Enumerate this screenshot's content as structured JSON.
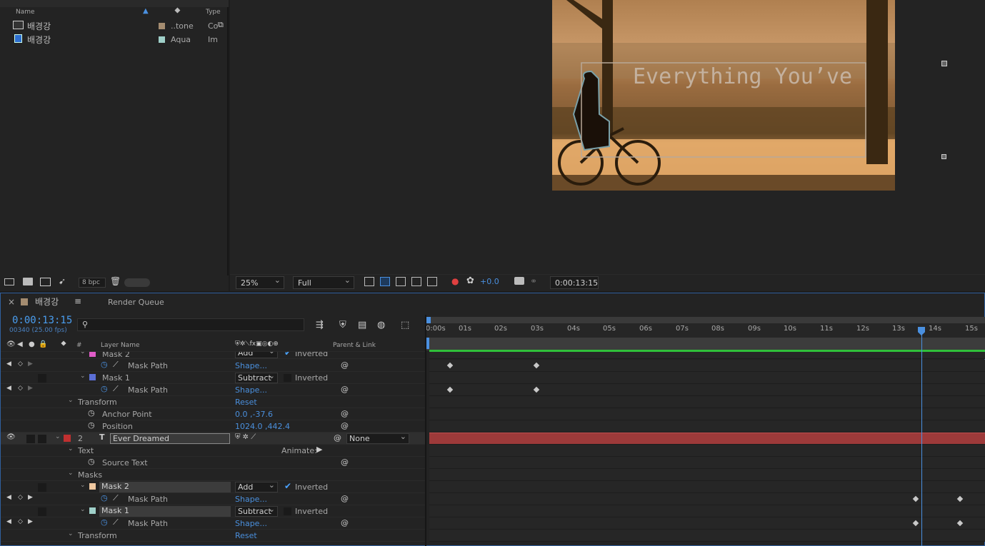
{
  "project": {
    "headers": {
      "name": "Name",
      "type": "Type"
    },
    "items": [
      {
        "name": "배경강",
        "label": "..tone",
        "type": "Co",
        "swatch": "#a48c70"
      },
      {
        "name": "배경강",
        "label": "Aqua",
        "type": "Im",
        "swatch": "#9fd0c9"
      }
    ],
    "bpc": "8 bpc"
  },
  "viewer": {
    "overlay_text": "Everything You’ve",
    "zoom": "25%",
    "resolution": "Full",
    "exposure": "+0.0",
    "timecode": "0:00:13:15"
  },
  "timeline": {
    "comp_tab": "배경강",
    "render_queue": "Render Queue",
    "timecode": "0:00:13:15",
    "frame_info": "00340 (25.00 fps)",
    "search_placeholder": "",
    "col_layer_name": "Layer Name",
    "col_parent": "Parent & Link",
    "col_hash": "#",
    "ruler": [
      "0:00s",
      "01s",
      "02s",
      "03s",
      "04s",
      "05s",
      "06s",
      "07s",
      "08s",
      "09s",
      "10s",
      "11s",
      "12s",
      "13s",
      "14s",
      "15s"
    ],
    "rows": {
      "mask2a": {
        "name": "Mask 2",
        "mode": "Add",
        "inverted": "Inverted"
      },
      "maskpath2a": {
        "name": "Mask Path",
        "value": "Shape..."
      },
      "mask1a": {
        "name": "Mask 1",
        "mode": "Subtract",
        "inverted": "Inverted"
      },
      "maskpath1a": {
        "name": "Mask Path",
        "value": "Shape..."
      },
      "transform_a": {
        "name": "Transform",
        "value": "Reset"
      },
      "anchor": {
        "name": "Anchor Point",
        "value": "0.0 ,-37.6"
      },
      "position": {
        "name": "Position",
        "value": "1024.0 ,442.4"
      },
      "layer2": {
        "num": "2",
        "name": "Ever Dreamed",
        "parent": "None"
      },
      "text": {
        "name": "Text",
        "animate": "Animate:"
      },
      "source_text": {
        "name": "Source Text"
      },
      "masks": {
        "name": "Masks"
      },
      "mask2b": {
        "name": "Mask 2",
        "mode": "Add",
        "inverted": "Inverted"
      },
      "maskpath2b": {
        "name": "Mask Path",
        "value": "Shape..."
      },
      "mask1b": {
        "name": "Mask 1",
        "mode": "Subtract",
        "inverted": "Inverted"
      },
      "maskpath1b": {
        "name": "Mask Path",
        "value": "Shape..."
      },
      "transform_b": {
        "name": "Transform",
        "value": "Reset"
      }
    }
  },
  "colors": {
    "accent": "#4a90e0",
    "layer_bar": "#9d3a3a",
    "work_area": "#2fbf3a",
    "mask_pink": "#e05cc8",
    "mask_blue": "#5b6fd6",
    "mask_peach": "#f0c8a0",
    "mask_aqua": "#9fd0c9",
    "layer_red": "#c03030"
  }
}
